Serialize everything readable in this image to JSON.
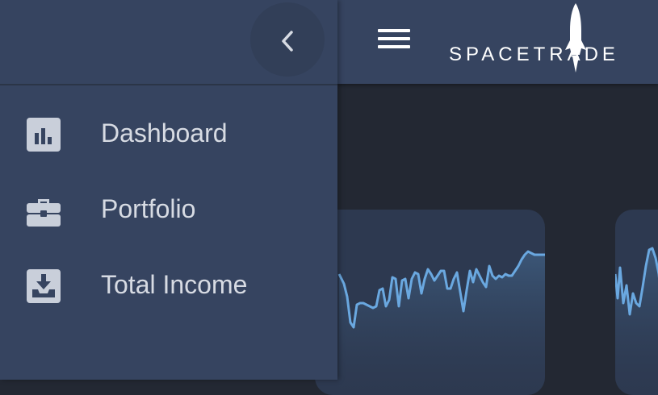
{
  "app": {
    "brand": "SPACETRADE"
  },
  "sidebar": {
    "items": [
      {
        "label": "Dashboard",
        "icon": "bar-chart-icon"
      },
      {
        "label": "Portfolio",
        "icon": "briefcase-icon"
      },
      {
        "label": "Total Income",
        "icon": "inbox-download-icon"
      }
    ]
  },
  "colors": {
    "sidebar": "#364460",
    "background": "#232833",
    "card": "#2d3950",
    "chart_line": "#6aa8e0"
  }
}
